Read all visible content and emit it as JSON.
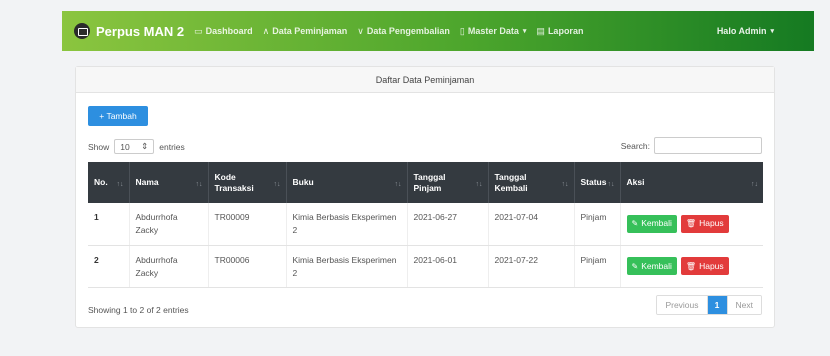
{
  "navbar": {
    "brand": "Perpus MAN 2",
    "items": [
      {
        "label": "Dashboard",
        "icon": "monitor-icon",
        "glyph": "▭"
      },
      {
        "label": "Data Peminjaman",
        "icon": "chevron-up-icon",
        "glyph": "∧"
      },
      {
        "label": "Data Pengembalian",
        "icon": "chevron-down-icon",
        "glyph": "∨"
      },
      {
        "label": "Master Data",
        "icon": "file-icon",
        "glyph": "▯"
      },
      {
        "label": "Laporan",
        "icon": "document-icon",
        "glyph": "▤"
      }
    ],
    "user": "Halo Admin"
  },
  "card": {
    "title": "Daftar Data Peminjaman",
    "add_button": "+ Tambah",
    "show_label": "Show",
    "entries_value": "10",
    "entries_label": "entries",
    "search_label": "Search:",
    "search_value": ""
  },
  "table": {
    "headers": [
      {
        "label": "No.",
        "sortable": true
      },
      {
        "label": "Nama",
        "sortable": true
      },
      {
        "label": "Kode Transaksi",
        "sortable": true
      },
      {
        "label": "Buku",
        "sortable": true
      },
      {
        "label": "Tanggal Pinjam",
        "sortable": true
      },
      {
        "label": "Tanggal Kembali",
        "sortable": true
      },
      {
        "label": "Status",
        "sortable": true
      },
      {
        "label": "Aksi",
        "sortable": true
      }
    ],
    "rows": [
      {
        "no": "1",
        "nama": "Abdurrhofa Zacky",
        "kode": "TR00009",
        "buku": "Kimia Berbasis Eksperimen 2",
        "pinjam": "2021-06-27",
        "kembali": "2021-07-04",
        "status": "Pinjam"
      },
      {
        "no": "2",
        "nama": "Abdurrhofa Zacky",
        "kode": "TR00006",
        "buku": "Kimia Berbasis Eksperimen 2",
        "pinjam": "2021-06-01",
        "kembali": "2021-07-22",
        "status": "Pinjam"
      }
    ],
    "kembali_label": "Kembali",
    "hapus_label": "Hapus"
  },
  "footer": {
    "info": "Showing 1 to 2 of 2 entries",
    "previous": "Previous",
    "page": "1",
    "next": "Next"
  },
  "colors": {
    "primary": "#2d8fe0",
    "success": "#36c05a",
    "danger": "#e23b3b",
    "table_header": "#343a40"
  }
}
